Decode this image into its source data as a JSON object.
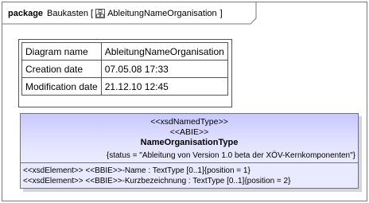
{
  "frame": {
    "keyword": "package",
    "package_name": "Baukasten",
    "open_bracket": "[",
    "diagram_name": "AbleitungNameOrganisation",
    "close_bracket": "]"
  },
  "info_table": [
    {
      "label": "Diagram name",
      "value": "AbleitungNameOrganisation"
    },
    {
      "label": "Creation date",
      "value": "07.05.08 17:33"
    },
    {
      "label": "Modification date",
      "value": "21.12.10 12:45"
    }
  ],
  "class_box": {
    "stereotype_1": "<<xsdNamedType>>",
    "stereotype_2": "<<ABIE>>",
    "name": "NameOrganisationType",
    "tagged_value": "{status = \"Ableitung von Version 1.0 beta der XÖV-Kernkomponenten\"}",
    "attributes": [
      "<<xsdElement>> <<BBIE>>-Name : TextType [0..1]{position = 1}",
      "<<xsdElement>> <<BBIE>>-Kurzbezeichnung : TextType [0..1]{position = 2}"
    ],
    "fill_color": "#eaeaff",
    "header_color": "#c8c8ff"
  }
}
